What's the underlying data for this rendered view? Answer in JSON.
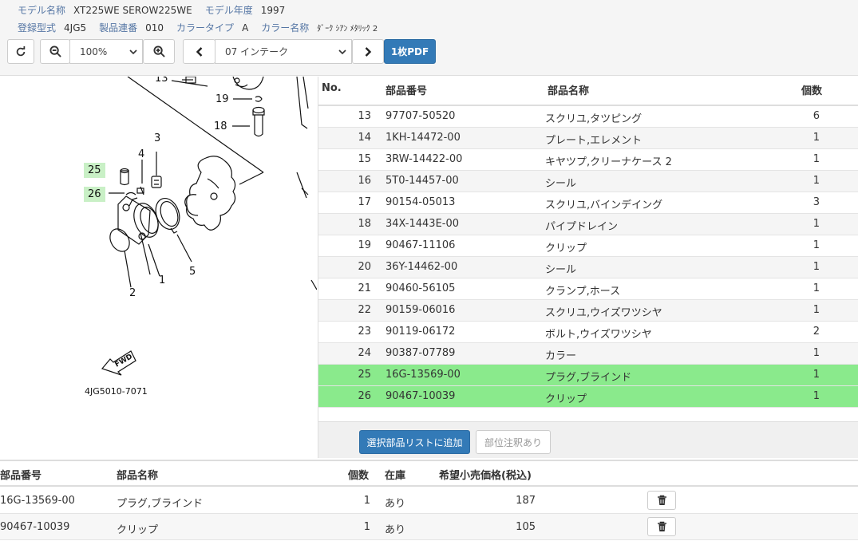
{
  "model_info": {
    "model_name_label": "モデル名称",
    "model_name": "XT225WE SEROW225WE",
    "model_year_label": "モデル年度",
    "model_year": "1997",
    "reg_type_label": "登録型式",
    "reg_type": "4JG5",
    "serial_label": "製品連番",
    "serial": "010",
    "color_type_label": "カラータイプ",
    "color_type": "A",
    "color_name_label": "カラー名称",
    "color_name": "ﾀﾞｰｸ ｼｱﾝ ﾒﾀﾘｯｸ 2"
  },
  "toolbar": {
    "zoom_value": "100%",
    "section_value": "07 インテーク",
    "pdf_label": "1枚PDF"
  },
  "diagram": {
    "callouts": [
      "13",
      "19",
      "18",
      "3",
      "4",
      "25",
      "26",
      "1",
      "5",
      "2"
    ],
    "fwd_label": "FWD",
    "code": "4JG5010-7071"
  },
  "parts_table": {
    "headers": {
      "no": "No.",
      "part_number": "部品番号",
      "part_name": "部品名称",
      "qty": "個数"
    },
    "rows": [
      {
        "no": "13",
        "part_number": "97707-50520",
        "part_name": "スクリユ,タツピング",
        "qty": "6"
      },
      {
        "no": "14",
        "part_number": "1KH-14472-00",
        "part_name": "プレート,エレメント",
        "qty": "1"
      },
      {
        "no": "15",
        "part_number": "3RW-14422-00",
        "part_name": "キヤツプ,クリーナケース 2",
        "qty": "1"
      },
      {
        "no": "16",
        "part_number": "5T0-14457-00",
        "part_name": "シール",
        "qty": "1"
      },
      {
        "no": "17",
        "part_number": "90154-05013",
        "part_name": "スクリユ,バインデイング",
        "qty": "3"
      },
      {
        "no": "18",
        "part_number": "34X-1443E-00",
        "part_name": "パイプドレイン",
        "qty": "1"
      },
      {
        "no": "19",
        "part_number": "90467-11106",
        "part_name": "クリップ",
        "qty": "1"
      },
      {
        "no": "20",
        "part_number": "36Y-14462-00",
        "part_name": "シール",
        "qty": "1"
      },
      {
        "no": "21",
        "part_number": "90460-56105",
        "part_name": "クランプ,ホース",
        "qty": "1"
      },
      {
        "no": "22",
        "part_number": "90159-06016",
        "part_name": "スクリユ,ウイズワツシヤ",
        "qty": "1"
      },
      {
        "no": "23",
        "part_number": "90119-06172",
        "part_name": "ボルト,ウイズワツシヤ",
        "qty": "2"
      },
      {
        "no": "24",
        "part_number": "90387-07789",
        "part_name": "カラー",
        "qty": "1"
      },
      {
        "no": "25",
        "part_number": "16G-13569-00",
        "part_name": "プラグ,ブラインド",
        "qty": "1"
      },
      {
        "no": "26",
        "part_number": "90467-10039",
        "part_name": "クリップ",
        "qty": "1"
      }
    ],
    "add_button": "選択部品リストに追加",
    "note_button": "部位注釈あり"
  },
  "selected_list": {
    "headers": {
      "part_number": "部品番号",
      "part_name": "部品名称",
      "qty": "個数",
      "stock": "在庫",
      "price": "希望小売価格(税込)"
    },
    "rows": [
      {
        "part_number": "16G-13569-00",
        "part_name": "プラグ,ブラインド",
        "qty": "1",
        "stock": "あり",
        "price": "187"
      },
      {
        "part_number": "90467-10039",
        "part_name": "クリップ",
        "qty": "1",
        "stock": "あり",
        "price": "105"
      }
    ]
  },
  "icons": {
    "refresh": "refresh-icon",
    "zoom_out": "zoom-out-icon",
    "zoom_in": "zoom-in-icon",
    "prev": "chevron-left-icon",
    "next": "chevron-right-icon",
    "delete": "trash-icon",
    "dropdown": "chevron-down-icon"
  },
  "colors": {
    "primary": "#337ab7",
    "selected_row": "#8aea8c",
    "callout_highlight": "#c9f0c6",
    "label_blue": "#5576a4"
  }
}
